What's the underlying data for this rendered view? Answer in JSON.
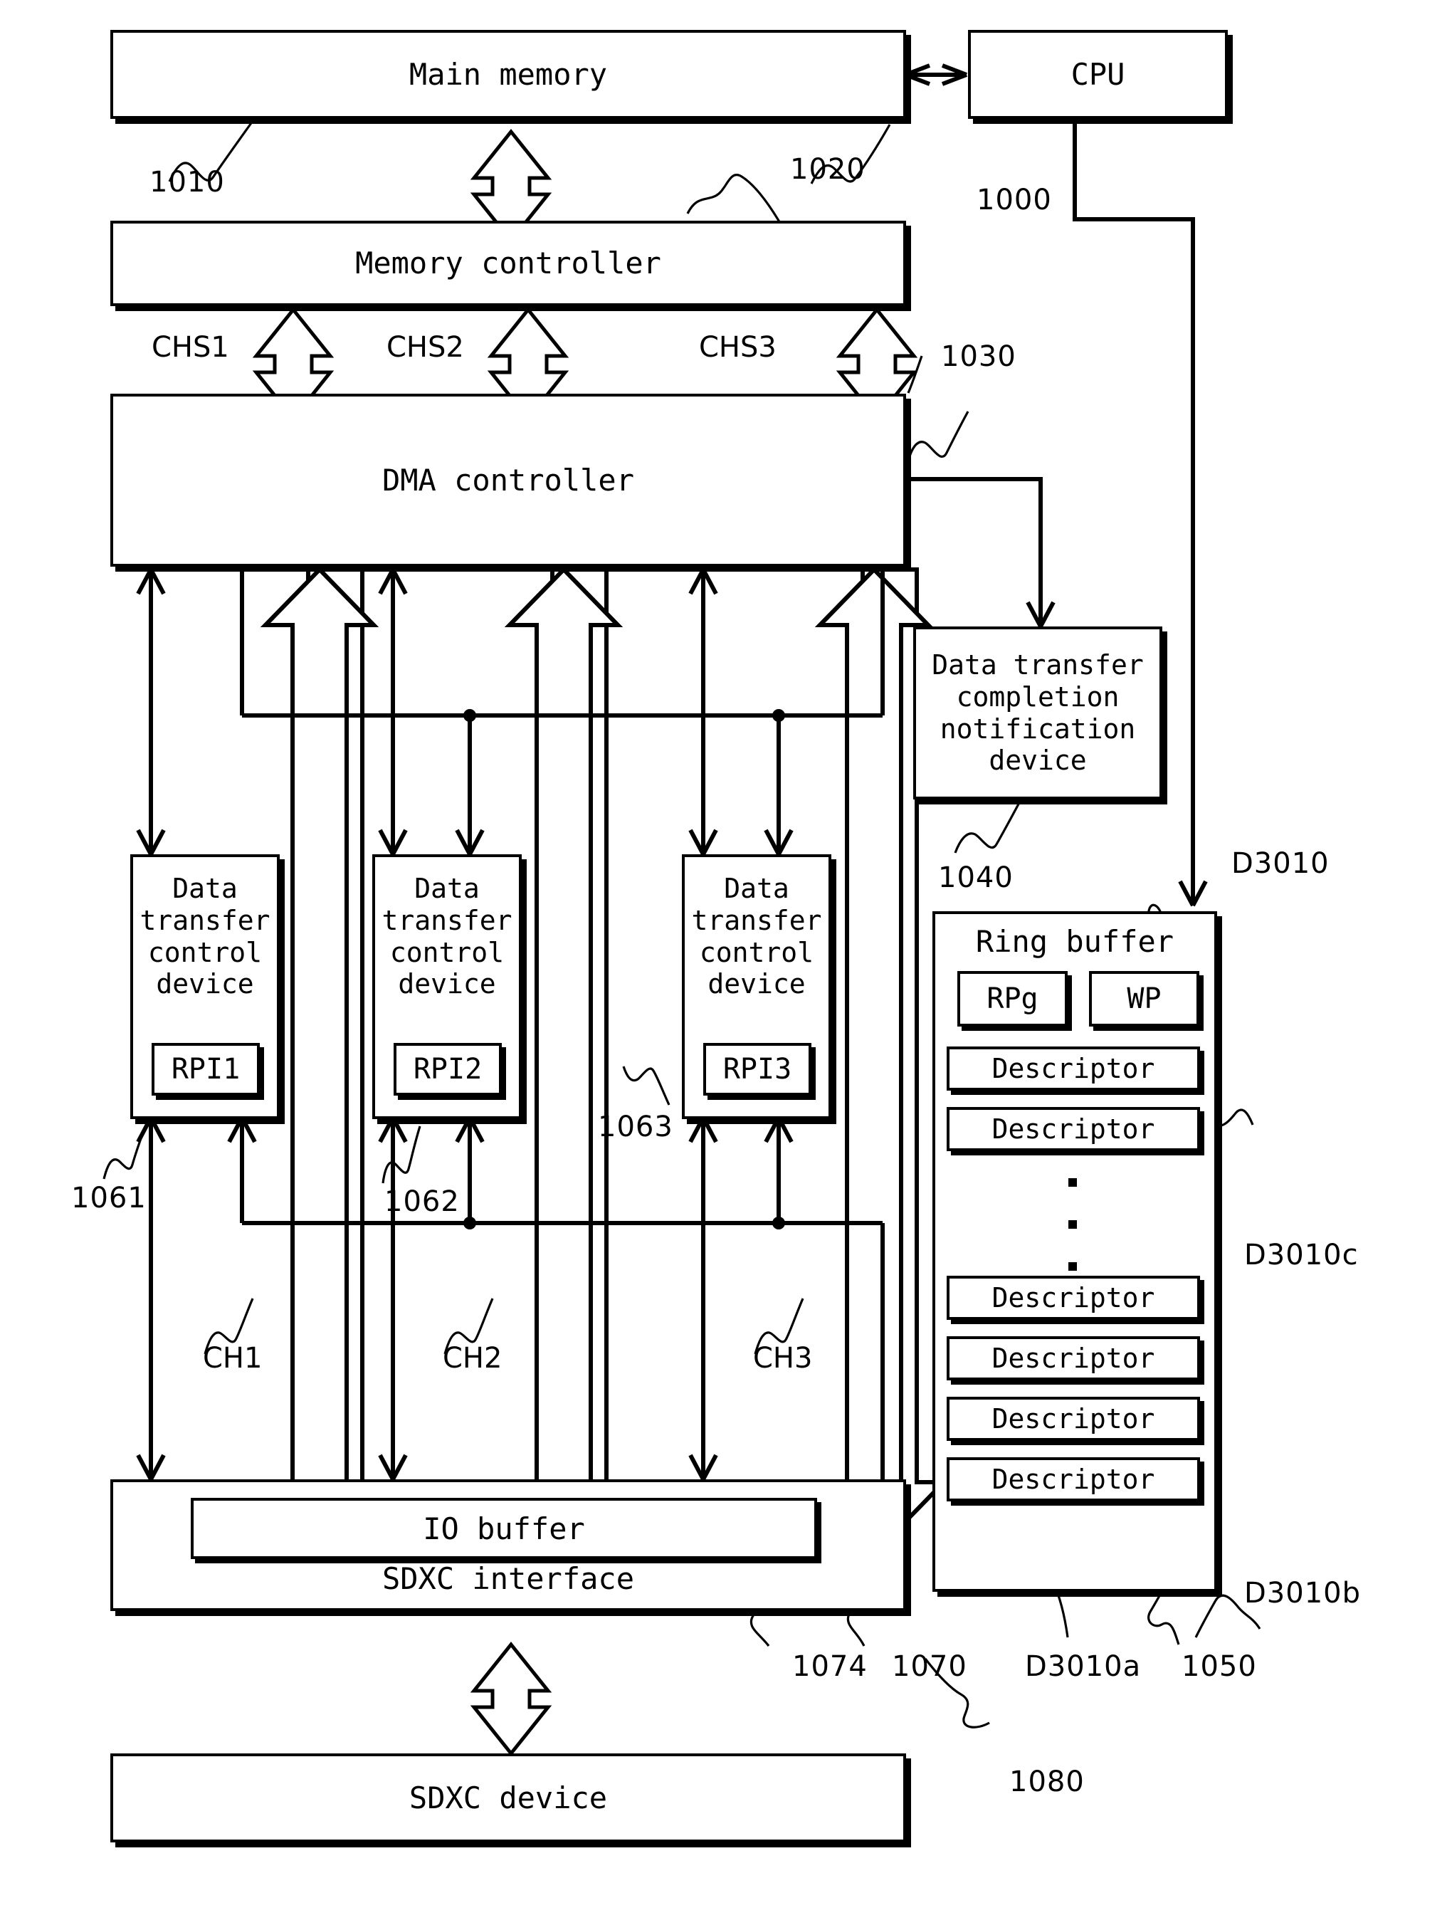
{
  "figure": {
    "type": "patent-block-diagram",
    "title": "DMA data transfer block diagram with ring buffer descriptors"
  },
  "blocks": {
    "main_memory": "Main memory",
    "cpu": "CPU",
    "memory_controller": "Memory controller",
    "dma_controller": "DMA controller",
    "completion_device": "Data transfer\ncompletion\nnotification\ndevice",
    "dtc1": "Data\ntransfer\ncontrol\ndevice",
    "dtc2": "Data\ntransfer\ncontrol\ndevice",
    "dtc3": "Data\ntransfer\ncontrol\ndevice",
    "rpi1": "RPI1",
    "rpi2": "RPI2",
    "rpi3": "RPI3",
    "ring_buffer": "Ring buffer",
    "rpg": "RPg",
    "wp": "WP",
    "descriptor": "Descriptor",
    "vertical_ellipsis": "·",
    "io_buffer": "IO buffer",
    "sdxc_interface": "SDXC interface",
    "sdxc_device": "SDXC device"
  },
  "descriptors": [
    "Descriptor",
    "Descriptor",
    "Descriptor",
    "Descriptor",
    "Descriptor",
    "Descriptor"
  ],
  "bus_labels": {
    "chs1": "CHS1",
    "chs2": "CHS2",
    "chs3": "CHS3",
    "ch1": "CH1",
    "ch2": "CH2",
    "ch3": "CH3"
  },
  "reference_numerals": {
    "main_memory": "1010",
    "cpu": "1000",
    "memory_controller": "1020",
    "chs_bus": "1030",
    "completion_device": "1040",
    "dtc1": "1061",
    "dtc2": "1062",
    "dtc3": "1063",
    "ring_buffer": "1050",
    "io_buffer": "1074",
    "sdxc_interface": "1070",
    "sdxc_device": "1080",
    "descriptor_top": "D3010",
    "descriptor_c": "D3010c",
    "descriptor_b": "D3010b",
    "descriptor_a": "D3010a"
  },
  "colors": {
    "stroke": "#000000",
    "fill": "#ffffff"
  }
}
